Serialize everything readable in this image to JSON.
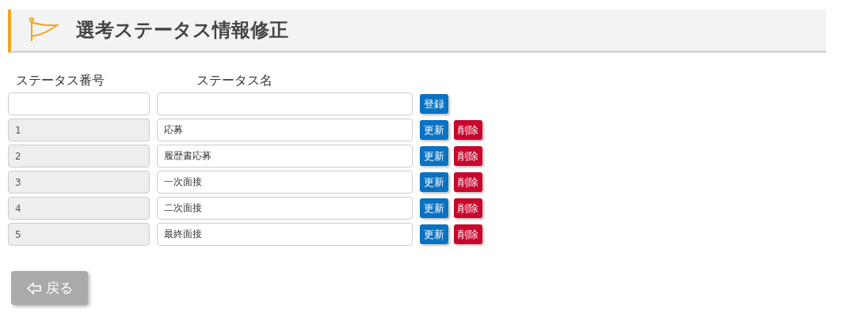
{
  "header": {
    "title": "選考ステータス情報修正"
  },
  "columns": [
    "ステータス番号",
    "ステータス名"
  ],
  "new_entry": {
    "register_button": "登録"
  },
  "rows": [
    {
      "number": "1",
      "name": "応募",
      "disabled": true,
      "update_button": "更新",
      "delete_button": "削除"
    },
    {
      "number": "2",
      "name": "履歴書応募",
      "disabled": true,
      "update_button": "更新",
      "delete_button": "削除"
    },
    {
      "number": "3",
      "name": "一次面接",
      "disabled": true,
      "update_button": "更新",
      "delete_button": "削除"
    },
    {
      "number": "4",
      "name": "二次面接",
      "disabled": true,
      "update_button": "更新",
      "delete_button": "削除"
    },
    {
      "number": "5",
      "name": "最終面接",
      "disabled": true,
      "update_button": "更新",
      "delete_button": "削除"
    }
  ],
  "back_button": {
    "label": "戻る"
  }
}
